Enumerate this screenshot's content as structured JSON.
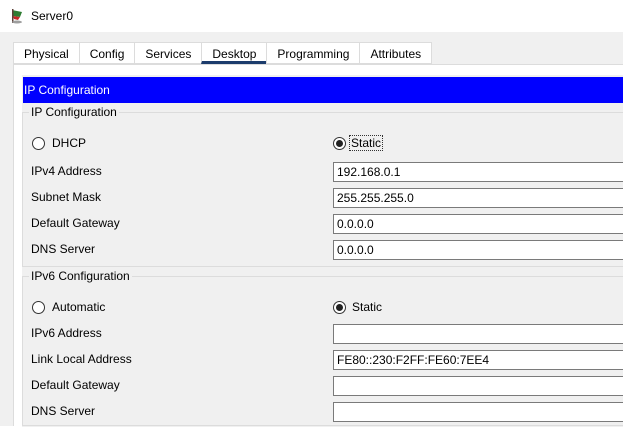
{
  "window": {
    "title": "Server0",
    "app_icon": "packet-tracer-server-icon"
  },
  "tabs": [
    {
      "label": "Physical",
      "active": false
    },
    {
      "label": "Config",
      "active": false
    },
    {
      "label": "Services",
      "active": false
    },
    {
      "label": "Desktop",
      "active": true
    },
    {
      "label": "Programming",
      "active": false
    },
    {
      "label": "Attributes",
      "active": false
    }
  ],
  "header": {
    "title": "IP Configuration",
    "color": "#0000ff"
  },
  "ipv4": {
    "legend": "IP Configuration",
    "dhcp_label": "DHCP",
    "static_label": "Static",
    "mode": "Static",
    "address_label": "IPv4 Address",
    "address": "192.168.0.1",
    "subnet_label": "Subnet Mask",
    "subnet": "255.255.255.0",
    "gateway_label": "Default Gateway",
    "gateway": "0.0.0.0",
    "dns_label": "DNS Server",
    "dns": "0.0.0.0"
  },
  "ipv6": {
    "legend": "IPv6 Configuration",
    "auto_label": "Automatic",
    "static_label": "Static",
    "mode": "Static",
    "address_label": "IPv6 Address",
    "address": "",
    "link_local_label": "Link Local Address",
    "link_local": "FE80::230:F2FF:FE60:7EE4",
    "gateway_label": "Default Gateway",
    "gateway": "",
    "dns_label": "DNS Server",
    "dns": ""
  }
}
